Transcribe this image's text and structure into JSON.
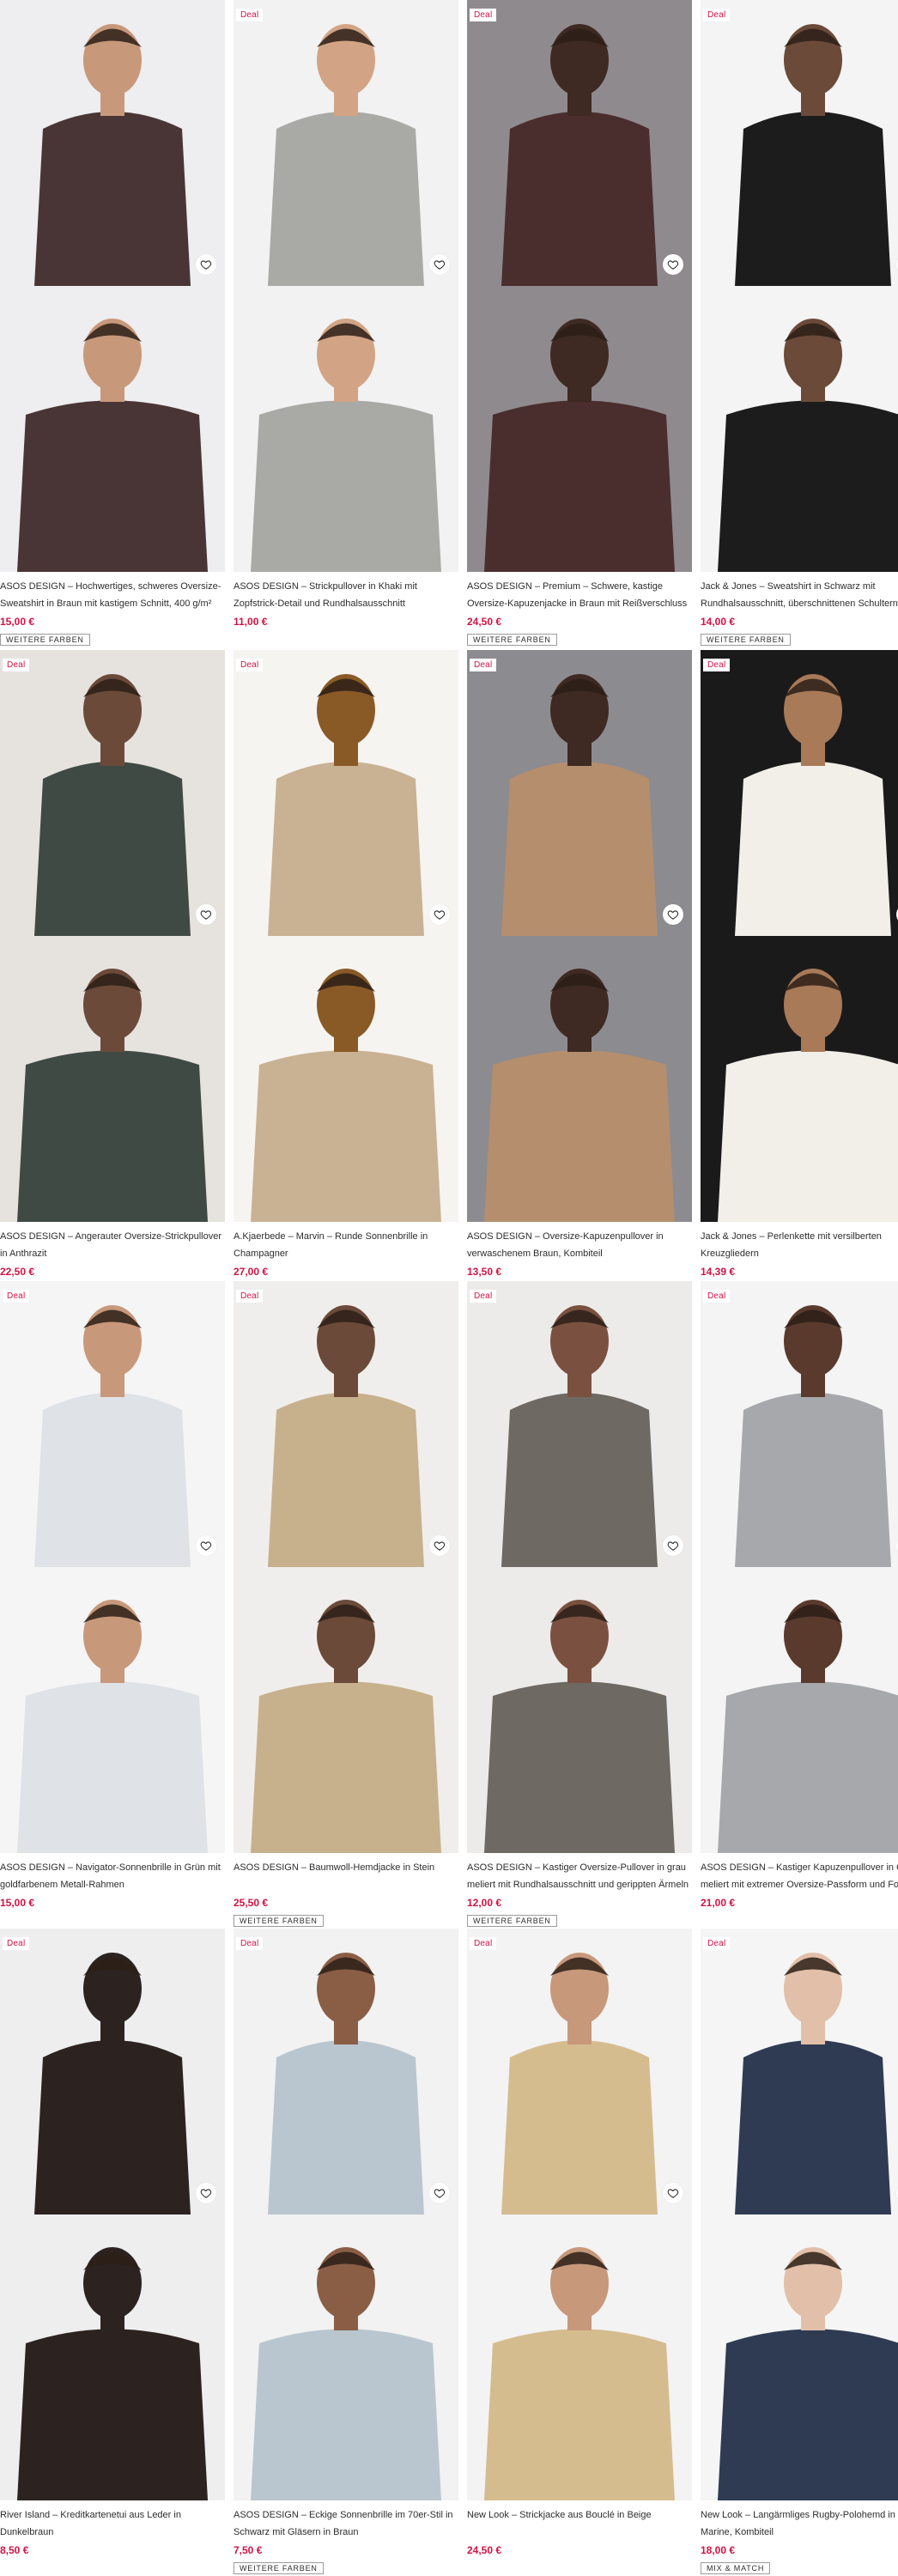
{
  "deal_label": "Deal",
  "products": [
    {
      "title": "ASOS DESIGN – Hochwertiges, schweres Oversize-Sweatshirt in Braun mit kastigem Schnitt, 400 g/m²",
      "price": "15,00 €",
      "more_colors": "Weitere Farben",
      "deal": false,
      "palette": {
        "bg": "#eeedef",
        "item": "#4a3536",
        "skin": "#c8987a",
        "pants": "#6d86a5"
      }
    },
    {
      "title": "ASOS DESIGN – Strickpullover in Khaki mit Zopfstrick-Detail und Rundhalsausschnitt",
      "price": "11,00 €",
      "more_colors": "",
      "deal": true,
      "palette": {
        "bg": "#f2f2f2",
        "item": "#a9aaa6",
        "skin": "#d2a485",
        "pants": "#8ea3b2"
      }
    },
    {
      "title": "ASOS DESIGN – Premium – Schwere, kastige Oversize-Kapuzenjacke in Braun mit Reißverschluss",
      "price": "24,50 €",
      "more_colors": "Weitere Farben",
      "deal": true,
      "palette": {
        "bg": "#8f8a8e",
        "item": "#4a2e2d",
        "skin": "#3e2a22",
        "pants": "#2a2a2a"
      }
    },
    {
      "title": "Jack & Jones – Sweatshirt in Schwarz mit Rundhalsausschnitt, überschnittenen Schultern",
      "price": "14,00 €",
      "more_colors": "Weitere Farben",
      "deal": true,
      "palette": {
        "bg": "#f4f4f4",
        "item": "#1c1c1c",
        "skin": "#6b4a3a",
        "pants": "#2a2a2a"
      }
    },
    {
      "title": "ASOS DESIGN – Angerauter Oversize-Strickpullover in Anthrazit",
      "price": "22,50 €",
      "more_colors": "",
      "deal": true,
      "palette": {
        "bg": "#e6e3df",
        "item": "#404a44",
        "skin": "#6b4a3a",
        "pants": "#e8e1d4"
      }
    },
    {
      "title": "A.Kjaerbede – Marvin – Runde Sonnenbrille in Champagner",
      "price": "27,00 €",
      "more_colors": "",
      "deal": true,
      "palette": {
        "bg": "#f6f4f1",
        "item": "#c8b293",
        "skin": "#8a5a26",
        "pants": "#ffffff"
      }
    },
    {
      "title": "ASOS DESIGN – Oversize-Kapuzenpullover in verwaschenem Braun, Kombiteil",
      "price": "13,50 €",
      "more_colors": "",
      "deal": true,
      "palette": {
        "bg": "#8c8b90",
        "item": "#b58e6e",
        "skin": "#3e2a22",
        "pants": "#9fb2c3"
      }
    },
    {
      "title": "Jack & Jones – Perlenkette mit versilberten Kreuzgliedern",
      "price": "14,39 €",
      "more_colors": "",
      "deal": true,
      "palette": {
        "bg": "#1a1a1a",
        "item": "#f1efe8",
        "skin": "#a87a58",
        "pants": "#111111"
      }
    },
    {
      "title": "ASOS DESIGN – Navigator-Sonnenbrille in Grün mit goldfarbenem Metall-Rahmen",
      "price": "15,00 €",
      "more_colors": "",
      "deal": true,
      "palette": {
        "bg": "#f5f5f5",
        "item": "#dfe2e7",
        "skin": "#c8987a",
        "pants": "#6b4e3d"
      }
    },
    {
      "title": "ASOS DESIGN – Baumwoll-Hemdjacke in Stein",
      "price": "25,50 €",
      "more_colors": "Weitere Farben",
      "deal": true,
      "palette": {
        "bg": "#f0eeec",
        "item": "#c7b18d",
        "skin": "#6b4a3a",
        "pants": "#c3cdd7"
      }
    },
    {
      "title": "ASOS DESIGN – Kastiger Oversize-Pullover in grau meliert mit Rundhalsausschnitt und gerippten Ärmeln",
      "price": "12,00 €",
      "more_colors": "Weitere Farben",
      "deal": true,
      "palette": {
        "bg": "#ecebea",
        "item": "#6f6963",
        "skin": "#7a5140",
        "pants": "#4a4a4a"
      }
    },
    {
      "title": "ASOS DESIGN – Kastiger Kapuzenpullover in Grau meliert mit extremer Oversize-Passform und Fotoprint",
      "price": "21,00 €",
      "more_colors": "",
      "deal": true,
      "palette": {
        "bg": "#f4f4f4",
        "item": "#a6a8ab",
        "skin": "#5a3a2d",
        "pants": "#2f2f2f"
      }
    },
    {
      "title": "River Island – Kreditkartenetui aus Leder in Dunkelbraun",
      "price": "8,50 €",
      "more_colors": "",
      "deal": true,
      "palette": {
        "bg": "#eeeeee",
        "item": "#2c2320",
        "skin": "#2c2320",
        "pants": "#eeeeee"
      }
    },
    {
      "title": "ASOS DESIGN – Eckige Sonnenbrille im 70er-Stil in Schwarz mit Gläsern in Braun",
      "price": "7,50 €",
      "more_colors": "Weitere Farben",
      "deal": true,
      "palette": {
        "bg": "#f2f2f2",
        "item": "#b9c6cf",
        "skin": "#8a5e45",
        "pants": "#4f87c4"
      }
    },
    {
      "title": "New Look – Strickjacke aus Bouclé in Beige",
      "price": "24,50 €",
      "more_colors": "",
      "deal": true,
      "palette": {
        "bg": "#f3f3f3",
        "item": "#d5bc8f",
        "skin": "#c8987a",
        "pants": "#575a57"
      }
    },
    {
      "title": "New Look – Langärmliges Rugby-Polohemd in Marine, Kombiteil",
      "price": "18,00 €",
      "more_colors": "Mix & Match",
      "deal": true,
      "palette": {
        "bg": "#f5f5f5",
        "item": "#2f3b53",
        "skin": "#e2bfa8",
        "pants": "#2a2a2a"
      }
    }
  ]
}
